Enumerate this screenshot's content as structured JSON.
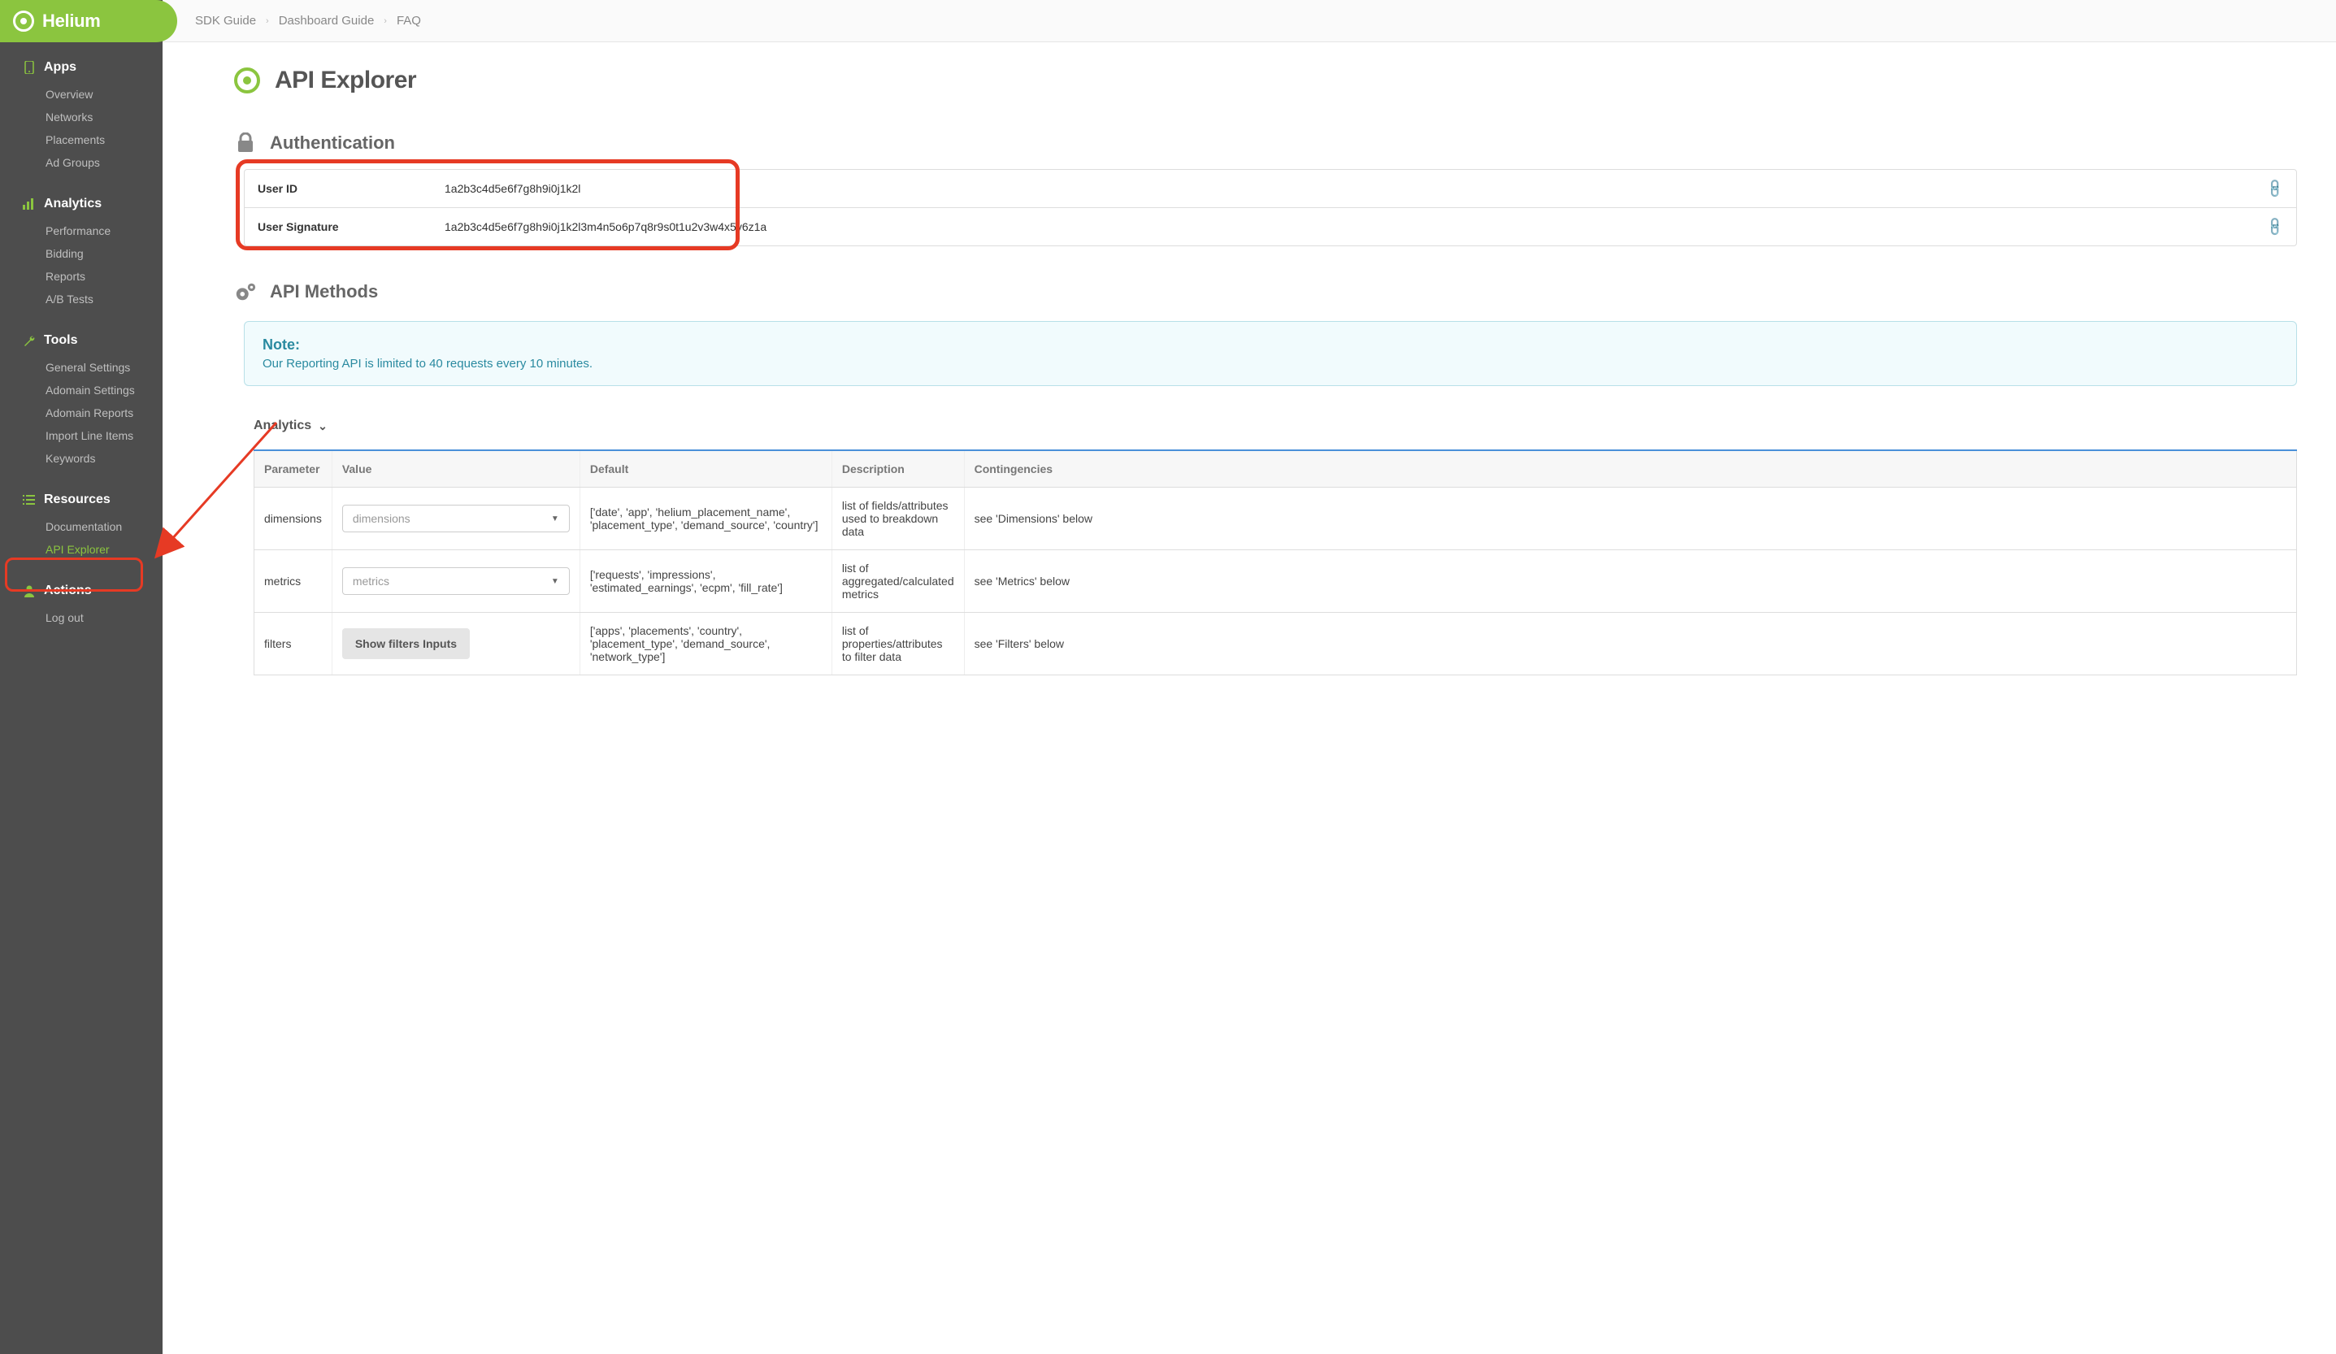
{
  "brand": "Helium",
  "breadcrumbs": [
    "SDK Guide",
    "Dashboard Guide",
    "FAQ"
  ],
  "sidebar": {
    "sections": [
      {
        "title": "Apps",
        "items": [
          "Overview",
          "Networks",
          "Placements",
          "Ad Groups"
        ]
      },
      {
        "title": "Analytics",
        "items": [
          "Performance",
          "Bidding",
          "Reports",
          "A/B Tests"
        ]
      },
      {
        "title": "Tools",
        "items": [
          "General Settings",
          "Adomain Settings",
          "Adomain Reports",
          "Import Line Items",
          "Keywords"
        ]
      },
      {
        "title": "Resources",
        "items": [
          "Documentation",
          "API Explorer"
        ]
      },
      {
        "title": "Actions",
        "items": [
          "Log out"
        ]
      }
    ]
  },
  "page": {
    "title": "API Explorer",
    "auth_header": "Authentication",
    "auth_rows": [
      {
        "label": "User ID",
        "value": "1a2b3c4d5e6f7g8h9i0j1k2l"
      },
      {
        "label": "User Signature",
        "value": "1a2b3c4d5e6f7g8h9i0j1k2l3m4n5o6p7q8r9s0t1u2v3w4x5y6z1a"
      }
    ],
    "methods_header": "API Methods",
    "note": {
      "title": "Note:",
      "text": "Our Reporting API is limited to 40 requests every 10 minutes."
    },
    "collapse_label": "Analytics",
    "table": {
      "headers": [
        "Parameter",
        "Value",
        "Default",
        "Description",
        "Contingencies"
      ],
      "rows": [
        {
          "param": "dimensions",
          "value_placeholder": "dimensions",
          "value_type": "select",
          "default": "['date', 'app', 'helium_placement_name', 'placement_type', 'demand_source', 'country']",
          "desc": "list of fields/attributes used to breakdown data",
          "cont": "see 'Dimensions' below"
        },
        {
          "param": "metrics",
          "value_placeholder": "metrics",
          "value_type": "select",
          "default": "['requests', 'impressions', 'estimated_earnings', 'ecpm', 'fill_rate']",
          "desc": "list of aggregated/calculated metrics",
          "cont": "see 'Metrics' below"
        },
        {
          "param": "filters",
          "value_placeholder": "Show filters Inputs",
          "value_type": "button",
          "default": "['apps', 'placements', 'country', 'placement_type', 'demand_source', 'network_type']",
          "desc": "list of properties/attributes to filter data",
          "cont": "see 'Filters' below"
        }
      ]
    }
  }
}
